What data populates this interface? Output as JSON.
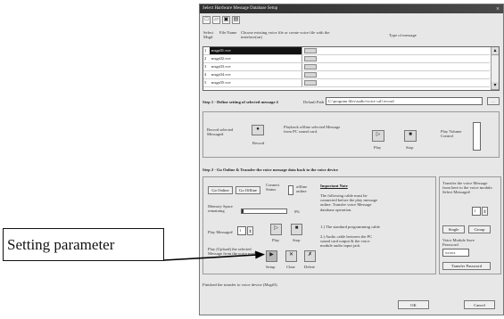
{
  "dialog": {
    "title": "Select Hardware Message Database Setup",
    "close_glyph": "×"
  },
  "toolbar": [
    "□",
    "▱",
    "▣",
    "▤"
  ],
  "header": {
    "col1": "Select Msg#",
    "col2": "File Name",
    "col3": "Choose existing voice file or create voice file with the interface(on)",
    "col4": "Type of message"
  },
  "list": {
    "rows": [
      {
        "num": "1",
        "name": "msgs01.vce"
      },
      {
        "num": "2",
        "name": "msgs02.vce"
      },
      {
        "num": "3",
        "name": "msgs03.vce"
      },
      {
        "num": "4",
        "name": "msgs04.vce"
      },
      {
        "num": "5",
        "name": "msgs05.vce"
      }
    ]
  },
  "step1": {
    "label": "Step 1 - Define setting of selected message #",
    "default_path_label": "Default Path",
    "default_path_value": "C:\\program files\\audio\\voice call record",
    "browse_label": "..."
  },
  "record_group": {
    "text": "Record selected Message#",
    "record_label": "Record",
    "play_text": "Playback offline selected Message from PC sound card.",
    "play_label": "Play",
    "stop_label": "Stop",
    "volume_label": "Play Volume Control"
  },
  "step2": {
    "label": "Step 2 - Go Online & Transfer the voice message data back to the voice device"
  },
  "online_group": {
    "go_online": "Go Online",
    "go_offline": "Go Offline",
    "connect_status": "Connect Status",
    "offline_status": "offline online",
    "memory_label": "Memory Space remaining",
    "memory_value": "0%",
    "play_msg_label": "Play Message#",
    "play_msg_value": "1",
    "play": "Play",
    "stop": "Stop",
    "play_desc": "Play (Upload) the selected Message from the voice module",
    "setup": "Setup",
    "clear": "Clear",
    "delete": "Delete"
  },
  "important": {
    "heading": "Important Note",
    "body": "The following cable must be connected before the play message online. Transfer voice Message database operation.",
    "item1": "1.) The standard programming cable",
    "item2": "2.) Audio cable between the PC sound card output & the voice module audio input jack"
  },
  "transfer_group": {
    "text": "Transfer the voice Message from here to the voice module. Select Message#",
    "msg_value": "1",
    "single": "Single",
    "group": "Group",
    "password_label": "Voice Module Save Password",
    "password_value": "xxxxx",
    "transfer_pw": "Transfer Password"
  },
  "status": {
    "text": "Finished the transfer to voice device (Msg#3)"
  },
  "footer": {
    "ok": "OK",
    "cancel": "Cancel"
  },
  "callout": {
    "text": "Setting parameter"
  }
}
